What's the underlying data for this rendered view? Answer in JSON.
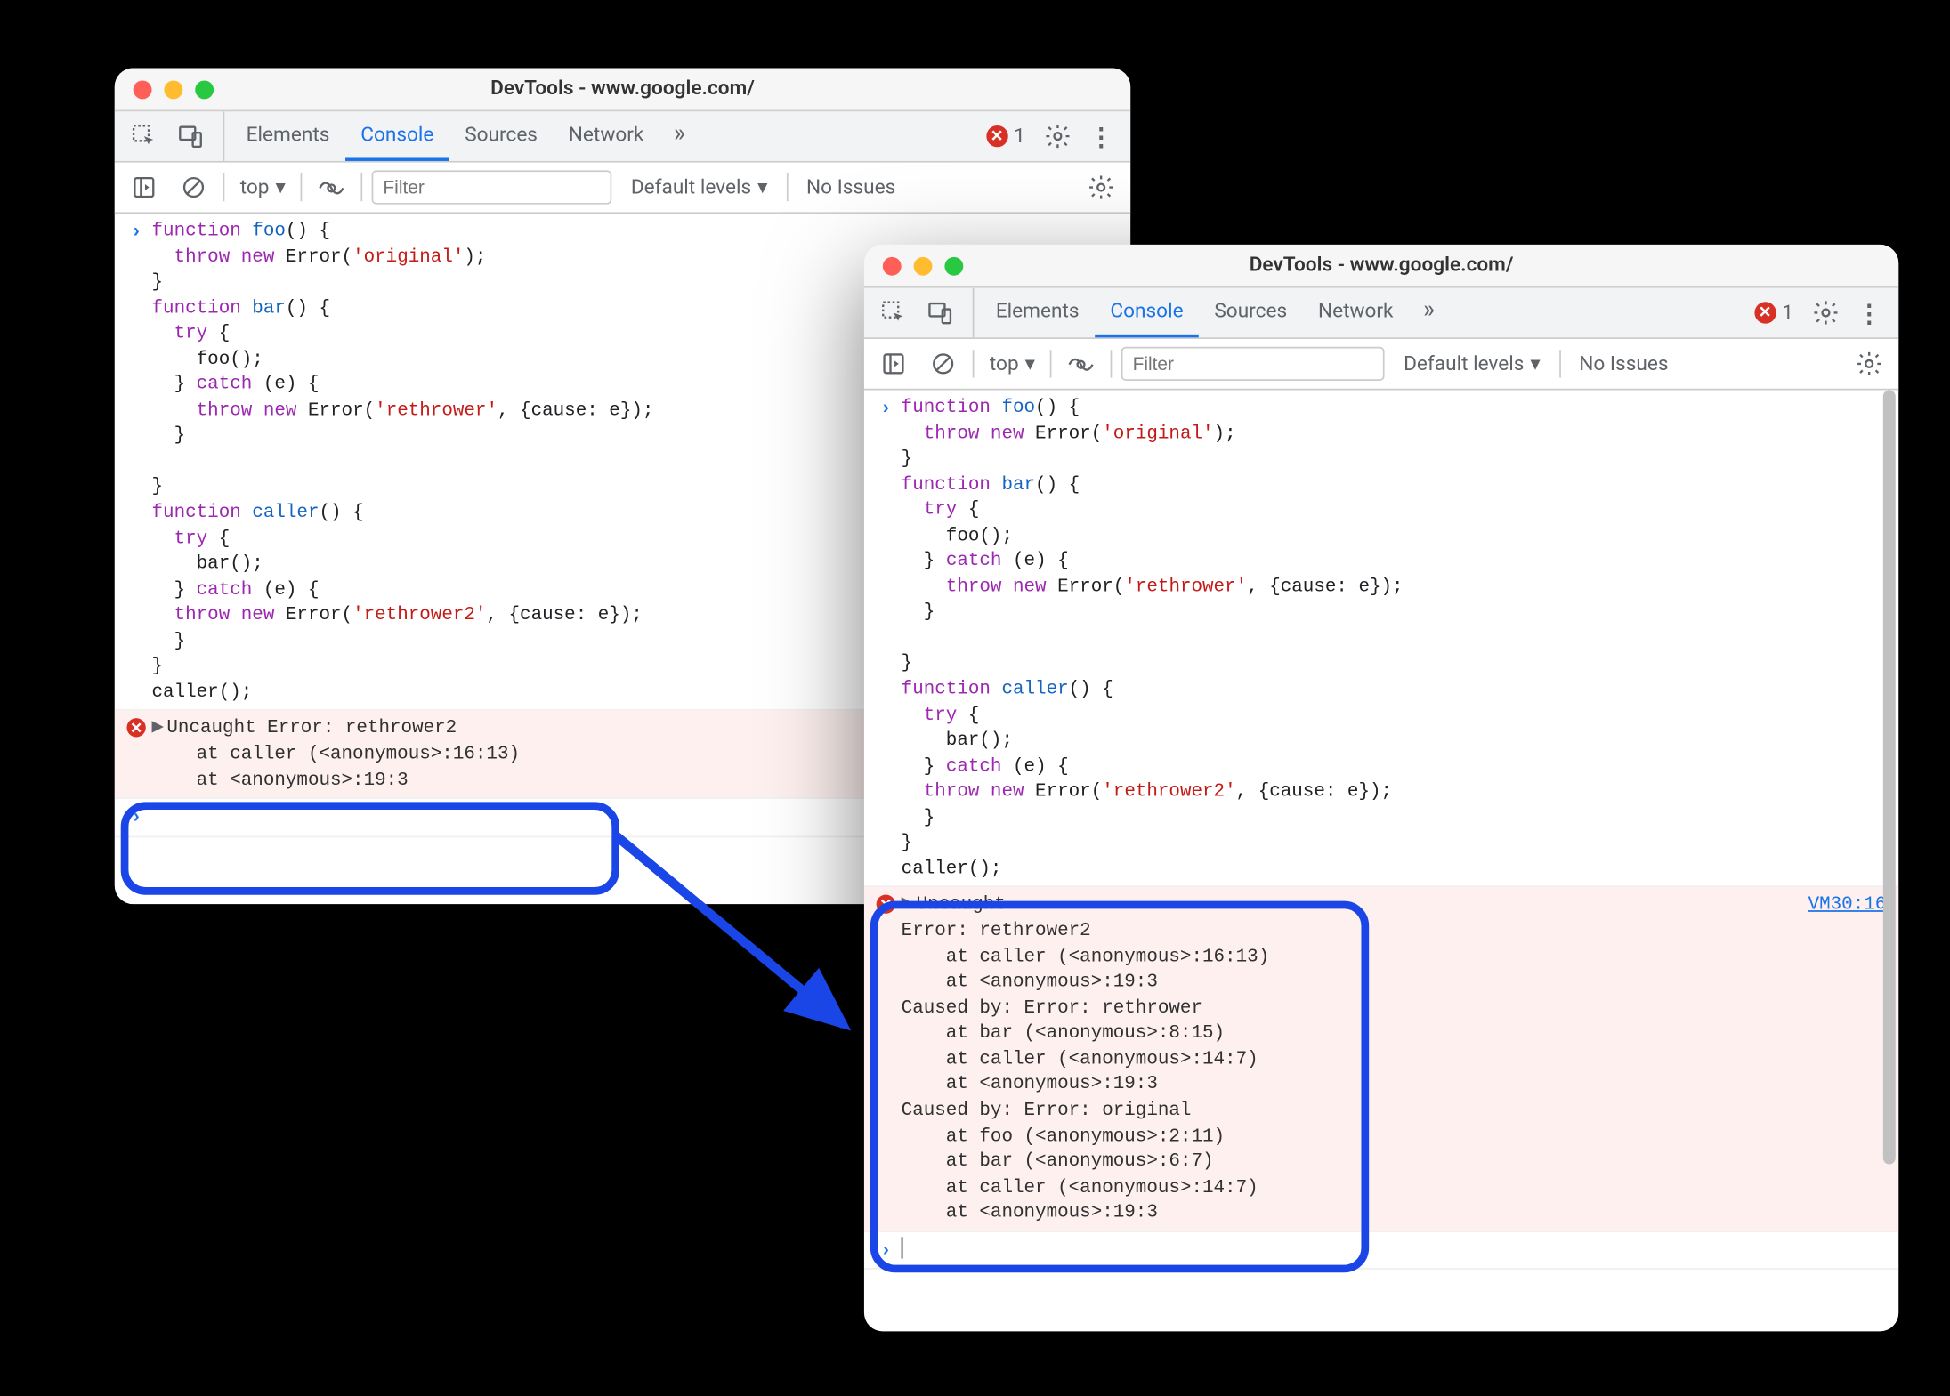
{
  "win1": {
    "title": "DevTools - www.google.com/",
    "tabs": [
      "Elements",
      "Console",
      "Sources",
      "Network"
    ],
    "activeTab": "Console",
    "errorCount": "1",
    "context": "top",
    "filterPlaceholder": "Filter",
    "levels": "Default levels",
    "issues": "No Issues",
    "error": {
      "l1": "Uncaught Error: rethrower2",
      "l2": "    at caller (<anonymous>:16:13)",
      "l3": "    at <anonymous>:19:3"
    }
  },
  "win2": {
    "title": "DevTools - www.google.com/",
    "tabs": [
      "Elements",
      "Console",
      "Sources",
      "Network"
    ],
    "activeTab": "Console",
    "errorCount": "1",
    "context": "top",
    "filterPlaceholder": "Filter",
    "levels": "Default levels",
    "issues": "No Issues",
    "srcLink": "VM30:16",
    "error": {
      "l1": "Uncaught",
      "l2": "Error: rethrower2",
      "l3": "    at caller (<anonymous>:16:13)",
      "l4": "    at <anonymous>:19:3",
      "l5": "Caused by: Error: rethrower",
      "l6": "    at bar (<anonymous>:8:15)",
      "l7": "    at caller (<anonymous>:14:7)",
      "l8": "    at <anonymous>:19:3",
      "l9": "Caused by: Error: original",
      "l10": "    at foo (<anonymous>:2:11)",
      "l11": "    at bar (<anonymous>:6:7)",
      "l12": "    at caller (<anonymous>:14:7)",
      "l13": "    at <anonymous>:19:3"
    }
  },
  "code": {
    "l1a": "function ",
    "l1b": "foo",
    "l1c": "() {",
    "l2a": "  throw ",
    "l2b": "new ",
    "l2c": "Error",
    "l2d": "(",
    "l2e": "'original'",
    "l2f": ");",
    "l3": "}",
    "l4a": "function ",
    "l4b": "bar",
    "l4c": "() {",
    "l5a": "  try ",
    "l5b": "{",
    "l6": "    foo();",
    "l7a": "  } ",
    "l7b": "catch ",
    "l7c": "(e) {",
    "l8a": "    throw ",
    "l8b": "new ",
    "l8c": "Error",
    "l8d": "(",
    "l8e": "'rethrower'",
    "l8f": ", {cause: e});",
    "l9": "  }",
    "l10": "",
    "l11": "}",
    "l12a": "function ",
    "l12b": "caller",
    "l12c": "() {",
    "l13a": "  try ",
    "l13b": "{",
    "l14": "    bar();",
    "l15a": "  } ",
    "l15b": "catch ",
    "l15c": "(e) {",
    "l16a": "  throw ",
    "l16b": "new ",
    "l16c": "Error",
    "l16d": "(",
    "l16e": "'rethrower2'",
    "l16f": ", {cause: e});",
    "l17": "  }",
    "l18": "}",
    "l19": "caller();"
  }
}
